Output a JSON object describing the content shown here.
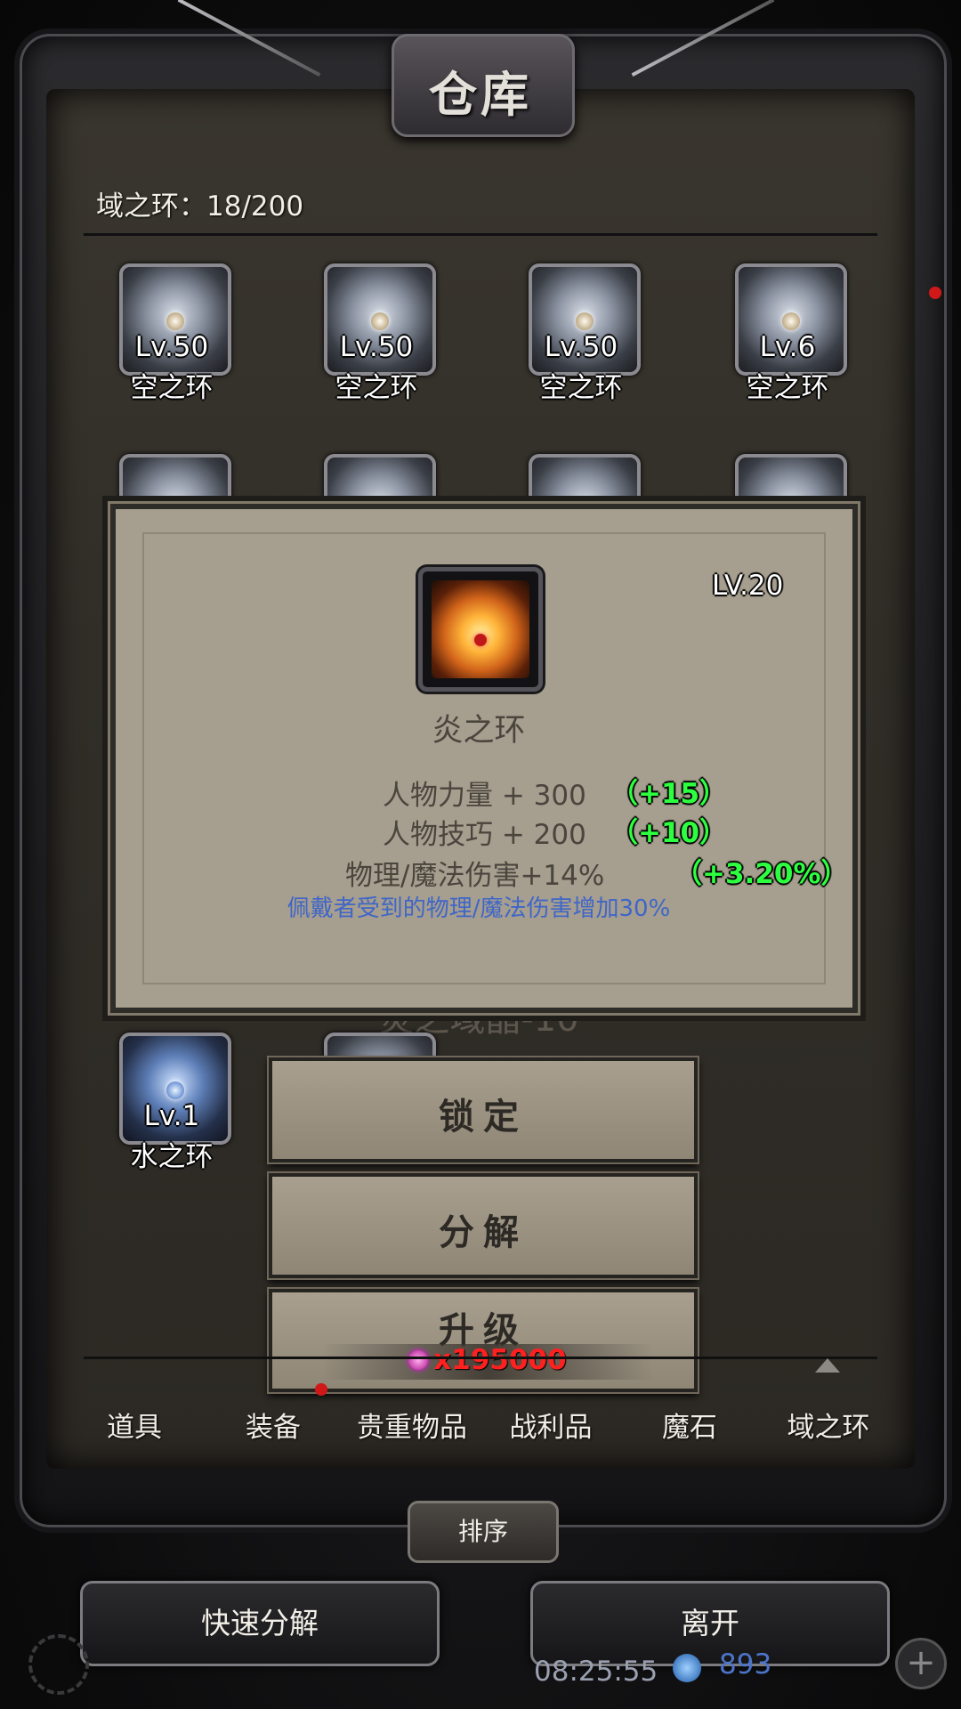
{
  "window": {
    "title": "仓库"
  },
  "storage": {
    "label": "域之环：18/200"
  },
  "slots": [
    {
      "level": "Lv.50",
      "name": "空之环"
    },
    {
      "level": "Lv.50",
      "name": "空之环"
    },
    {
      "level": "Lv.50",
      "name": "空之环"
    },
    {
      "level": "Lv.6",
      "name": "空之环"
    },
    {
      "level": "Lv.1",
      "name": "水之环"
    }
  ],
  "tooltip": {
    "level": "LV.20",
    "name": "炎之环",
    "stats": [
      {
        "text": "人物力量 + 300",
        "bonus": "（+15）"
      },
      {
        "text": "人物技巧 + 200",
        "bonus": "（+10）"
      },
      {
        "text": "物理/魔法伤害+14%",
        "bonus": "（+3.20%）"
      }
    ],
    "description": "佩戴者受到的物理/魔法伤害增加30%",
    "behind_text": "炎之域晶-10"
  },
  "actions": {
    "lock": "锁定",
    "decompose": "分解",
    "upgrade": "升级",
    "upgrade_cost": "x195000"
  },
  "tabs": [
    "道具",
    "装备",
    "贵重物品",
    "战利品",
    "魔石",
    "域之环"
  ],
  "sort": {
    "label": "排序"
  },
  "footer": {
    "quick_decompose": "快速分解",
    "leave": "离开",
    "time": "08:25:55",
    "gems": "893"
  },
  "colors": {
    "bonus_green": "#2dff40",
    "desc_blue": "#3f66c8",
    "cost_red": "#ff2020"
  }
}
